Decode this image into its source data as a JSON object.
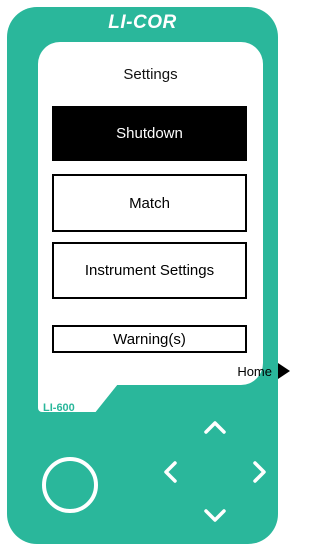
{
  "device": {
    "brand": "LI-COR",
    "model": "LI-600",
    "body_color": "#2ab79b"
  },
  "screen": {
    "title": "Settings",
    "buttons": [
      {
        "label": "Shutdown",
        "selected": true
      },
      {
        "label": "Match",
        "selected": false
      },
      {
        "label": "Instrument Settings",
        "selected": false
      },
      {
        "label": "Warning(s)",
        "selected": false
      }
    ],
    "home_label": "Home"
  },
  "controls": {
    "power": "power-button",
    "dpad": [
      "up",
      "left",
      "right",
      "down"
    ]
  }
}
